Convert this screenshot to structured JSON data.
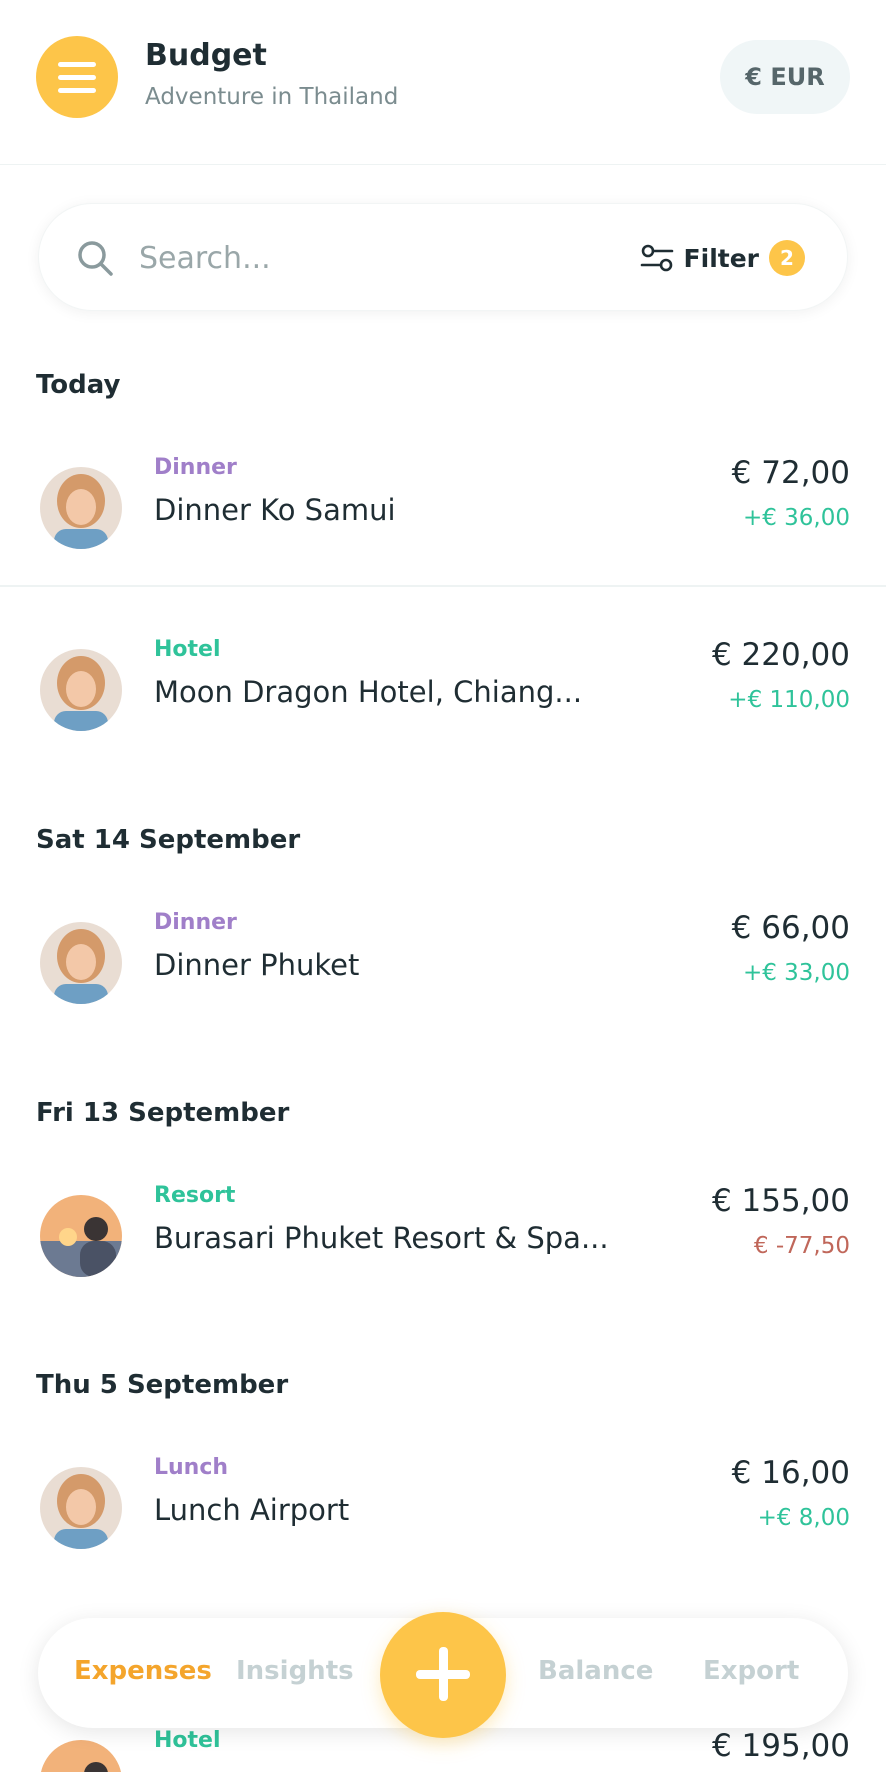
{
  "header": {
    "title": "Budget",
    "subtitle": "Adventure in Thailand",
    "currency_label": "€ EUR"
  },
  "search": {
    "placeholder": "Search...",
    "filter_label": "Filter",
    "filter_count": "2"
  },
  "colors": {
    "accent_yellow": "#fdc549",
    "category_purple": "#a07fc9",
    "category_green": "#2fc39a",
    "positive_green": "#2fc39a",
    "negative_red": "#c0675a"
  },
  "sections": [
    {
      "heading": "Today",
      "items": [
        {
          "category": "Dinner",
          "category_color": "#a07fc9",
          "title": "Dinner Ko Samui",
          "amount": "€ 72,00",
          "share": "+€ 36,00",
          "share_color": "#2fc39a",
          "avatar": "woman-avatar"
        },
        {
          "category": "Hotel",
          "category_color": "#2fc39a",
          "title": "Moon Dragon Hotel, Chiang...",
          "amount": "€ 220,00",
          "share": "+€ 110,00",
          "share_color": "#2fc39a",
          "avatar": "woman-avatar"
        }
      ]
    },
    {
      "heading": "Sat 14 September",
      "items": [
        {
          "category": "Dinner",
          "category_color": "#a07fc9",
          "title": "Dinner Phuket",
          "amount": "€ 66,00",
          "share": "+€ 33,00",
          "share_color": "#2fc39a",
          "avatar": "woman-avatar"
        }
      ]
    },
    {
      "heading": "Fri 13 September",
      "items": [
        {
          "category": "Resort",
          "category_color": "#2fc39a",
          "title": "Burasari Phuket Resort & Spa...",
          "amount": "€ 155,00",
          "share": "€ -77,50",
          "share_color": "#c0675a",
          "avatar": "man-sunset-avatar"
        }
      ]
    },
    {
      "heading": "Thu 5 September",
      "items": [
        {
          "category": "Lunch",
          "category_color": "#a07fc9",
          "title": "Lunch Airport",
          "amount": "€ 16,00",
          "share": "+€ 8,00",
          "share_color": "#2fc39a",
          "avatar": "woman-avatar"
        }
      ]
    }
  ],
  "partial_item": {
    "category": "Hotel",
    "category_color": "#2fc39a",
    "amount": "€ 195,00",
    "avatar": "man-sunset-avatar"
  },
  "bottom_nav": {
    "tabs": [
      "Expenses",
      "Insights",
      "Balance",
      "Export"
    ],
    "active": "Expenses",
    "add_icon": "plus-icon"
  }
}
